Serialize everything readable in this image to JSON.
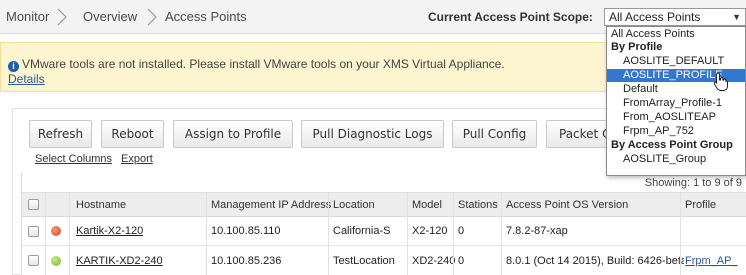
{
  "breadcrumb": {
    "items": [
      "Monitor",
      "Overview",
      "Access Points"
    ]
  },
  "scope": {
    "label": "Current Access Point Scope:",
    "selected": "All Access Points"
  },
  "dropdown": {
    "options": [
      {
        "text": "All Access Points",
        "kind": "top"
      },
      {
        "text": "By Profile",
        "kind": "group"
      },
      {
        "text": "AOSLITE_DEFAULT",
        "kind": "child"
      },
      {
        "text": "AOSLITE_PROFILE",
        "kind": "child",
        "highlighted": true
      },
      {
        "text": "Default",
        "kind": "child"
      },
      {
        "text": "FromArray_Profile-1",
        "kind": "child"
      },
      {
        "text": "From_AOSLITEAP",
        "kind": "child"
      },
      {
        "text": "Frpm_AP_752",
        "kind": "child"
      },
      {
        "text": "By Access Point Group",
        "kind": "group"
      },
      {
        "text": "AOSLITE_Group",
        "kind": "child"
      }
    ]
  },
  "alert": {
    "message": "VMware tools are not installed. Please install VMware tools on your XMS Virtual Appliance.",
    "link": "Details",
    "icon": "info-icon"
  },
  "toolbar": {
    "refresh": "Refresh",
    "reboot": "Reboot",
    "assign_profile": "Assign to Profile",
    "pull_logs": "Pull Diagnostic Logs",
    "pull_config": "Pull Config",
    "packet_capture": "Packet Ca"
  },
  "links": {
    "select_columns": "Select Columns",
    "export": "Export"
  },
  "table": {
    "showing": "Showing: 1 to 9 of 9",
    "headers": {
      "hostname": "Hostname",
      "mgmt_ip": "Management IP Address",
      "location": "Location",
      "model": "Model",
      "stations": "Stations",
      "os_version": "Access Point OS Version",
      "profile": "Profile"
    },
    "rows": [
      {
        "status_color": "#e0522a",
        "hostname": "Kartik-X2-120",
        "mgmt_ip": "10.100.85.110",
        "location": "California-S",
        "model": "X2-120",
        "stations": "0",
        "os_version": "7.8.2-87-xap",
        "profile": ""
      },
      {
        "status_color": "#8cc63f",
        "hostname": "KARTIK-XD2-240",
        "mgmt_ip": "10.100.85.236",
        "location": "TestLocation",
        "model": "XD2-240",
        "stations": "0",
        "os_version": "8.0.1 (Oct 14 2015), Build: 6426-beta",
        "profile": "Frpm_AP_"
      }
    ]
  }
}
